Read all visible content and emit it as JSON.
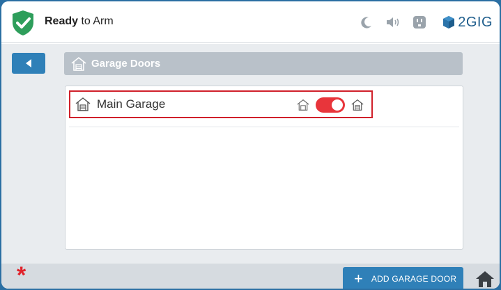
{
  "header": {
    "status_bold": "Ready",
    "status_rest": " to Arm",
    "brand": "2GIG",
    "icons": [
      "moon-icon",
      "speaker-icon",
      "outlet-icon"
    ]
  },
  "page": {
    "title": "Garage Doors"
  },
  "garage_list": [
    {
      "label": "Main Garage",
      "toggle_state": "on"
    }
  ],
  "footer": {
    "asterisk": "*",
    "add_button_label": "ADD GARAGE DOOR"
  },
  "colors": {
    "accent_blue": "#2f80b8",
    "shield_green": "#2e9e5b",
    "toggle_red": "#e8353b",
    "highlight_red": "#d0202a"
  }
}
